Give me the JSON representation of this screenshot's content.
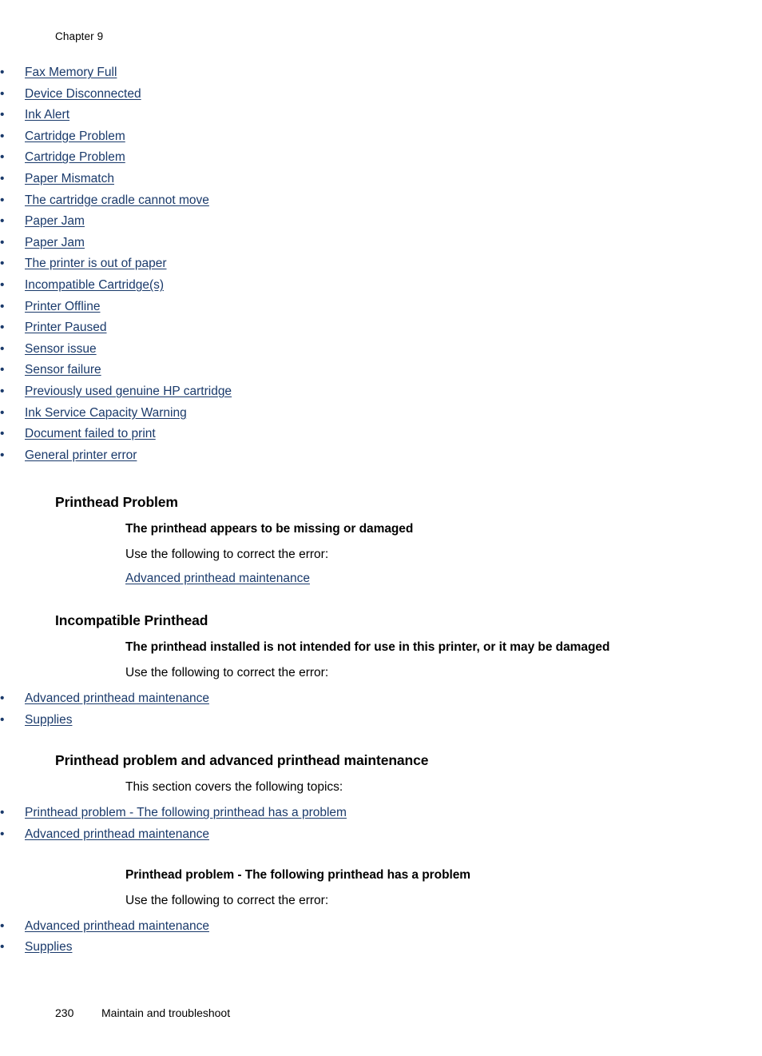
{
  "page": {
    "running_header": "Chapter 9",
    "footer": {
      "page_number": "230",
      "title": "Maintain and troubleshoot"
    },
    "link_color": "#1a3a6b",
    "text_color": "#000000",
    "background_color": "#ffffff",
    "bullet_glyph": "•"
  },
  "toc_list": {
    "items": [
      {
        "label": "Fax Memory Full"
      },
      {
        "label": "Device Disconnected"
      },
      {
        "label": "Ink Alert"
      },
      {
        "label": "Cartridge Problem"
      },
      {
        "label": "Cartridge Problem"
      },
      {
        "label": "Paper Mismatch"
      },
      {
        "label": "The cartridge cradle cannot move"
      },
      {
        "label": "Paper Jam"
      },
      {
        "label": "Paper Jam"
      },
      {
        "label": "The printer is out of paper"
      },
      {
        "label": "Incompatible Cartridge(s)"
      },
      {
        "label": "Printer Offline"
      },
      {
        "label": "Printer Paused"
      },
      {
        "label": "Sensor issue"
      },
      {
        "label": "Sensor failure"
      },
      {
        "label": "Previously used genuine HP cartridge"
      },
      {
        "label": "Ink Service Capacity Warning"
      },
      {
        "label": "Document failed to print"
      },
      {
        "label": "General printer error"
      }
    ]
  },
  "sections": [
    {
      "heading": "Printhead Problem",
      "sub_heading": "The printhead appears to be missing or damaged",
      "body_text": "Use the following to correct the error:",
      "links": [
        {
          "label": "Advanced printhead maintenance"
        }
      ]
    },
    {
      "heading": "Incompatible Printhead",
      "sub_heading": "The printhead installed is not intended for use in this printer, or it may be damaged",
      "body_text": "Use the following to correct the error:",
      "links": [
        {
          "label": "Advanced printhead maintenance"
        },
        {
          "label": "Supplies"
        }
      ]
    },
    {
      "heading": "Printhead problem and advanced printhead maintenance",
      "body_text": "This section covers the following topics:",
      "links": [
        {
          "label": "Printhead problem - The following printhead has a problem"
        },
        {
          "label": "Advanced printhead maintenance"
        }
      ],
      "subsection": {
        "sub_heading": "Printhead problem - The following printhead has a problem",
        "body_text": "Use the following to correct the error:",
        "links": [
          {
            "label": "Advanced printhead maintenance"
          },
          {
            "label": "Supplies"
          }
        ]
      }
    }
  ]
}
